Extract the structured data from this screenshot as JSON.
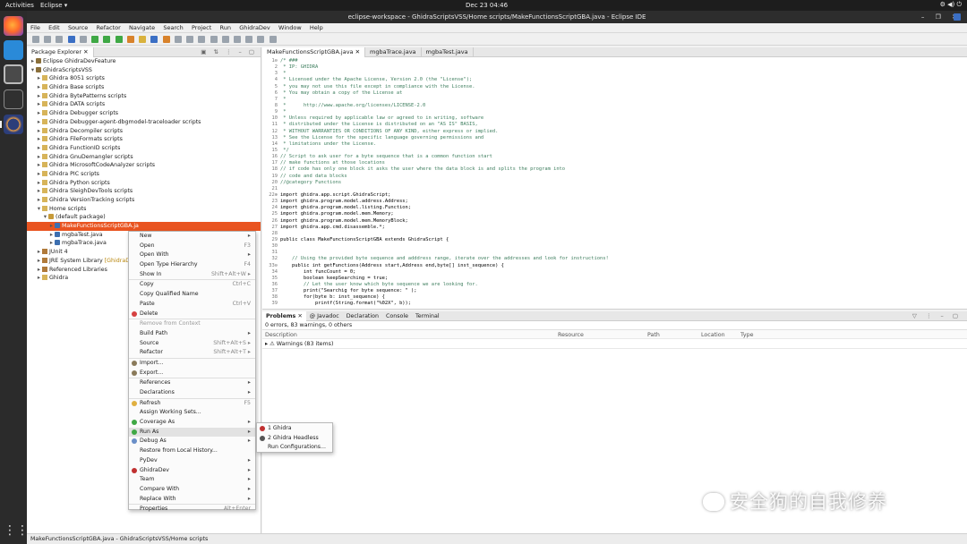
{
  "topbar": {
    "activities": "Activities",
    "app_menu": "Eclipse ▾",
    "clock": "Dec 23  04:46",
    "tray": "⚙ ◀) ⏻"
  },
  "window": {
    "title": "eclipse-workspace - GhidraScriptsVSS/Home scripts/MakeFunctionsScriptGBA.java - Eclipse IDE",
    "controls": "– ❐ ✕"
  },
  "menubar": [
    "File",
    "Edit",
    "Source",
    "Refactor",
    "Navigate",
    "Search",
    "Project",
    "Run",
    "GhidraDev",
    "Window",
    "Help"
  ],
  "explorer": {
    "tab_label": "Package Explorer ✕",
    "tree": [
      {
        "twisty": "▸",
        "icon": "proj",
        "label": "Eclipse GhidraDevFeature",
        "indent": 0
      },
      {
        "twisty": "▾",
        "icon": "proj",
        "label": "GhidraScriptsVSS",
        "indent": 0
      },
      {
        "twisty": "▸",
        "icon": "fold",
        "label": "Ghidra 8051 scripts",
        "indent": 1
      },
      {
        "twisty": "▸",
        "icon": "fold",
        "label": "Ghidra Base scripts",
        "indent": 1
      },
      {
        "twisty": "▸",
        "icon": "fold",
        "label": "Ghidra BytePatterns scripts",
        "indent": 1
      },
      {
        "twisty": "▸",
        "icon": "fold",
        "label": "Ghidra DATA scripts",
        "indent": 1
      },
      {
        "twisty": "▸",
        "icon": "fold",
        "label": "Ghidra Debugger scripts",
        "indent": 1
      },
      {
        "twisty": "▸",
        "icon": "fold",
        "label": "Ghidra Debugger-agent-dbgmodel-traceloader scripts",
        "indent": 1
      },
      {
        "twisty": "▸",
        "icon": "fold",
        "label": "Ghidra Decompiler scripts",
        "indent": 1
      },
      {
        "twisty": "▸",
        "icon": "fold",
        "label": "Ghidra FileFormats scripts",
        "indent": 1
      },
      {
        "twisty": "▸",
        "icon": "fold",
        "label": "Ghidra FunctionID scripts",
        "indent": 1
      },
      {
        "twisty": "▸",
        "icon": "fold",
        "label": "Ghidra GnuDemangler scripts",
        "indent": 1
      },
      {
        "twisty": "▸",
        "icon": "fold",
        "label": "Ghidra MicrosoftCodeAnalyzer scripts",
        "indent": 1
      },
      {
        "twisty": "▸",
        "icon": "fold",
        "label": "Ghidra PIC scripts",
        "indent": 1
      },
      {
        "twisty": "▸",
        "icon": "fold",
        "label": "Ghidra Python scripts",
        "indent": 1
      },
      {
        "twisty": "▸",
        "icon": "fold",
        "label": "Ghidra SleighDevTools scripts",
        "indent": 1
      },
      {
        "twisty": "▸",
        "icon": "fold",
        "label": "Ghidra VersionTracking scripts",
        "indent": 1
      },
      {
        "twisty": "▾",
        "icon": "fold",
        "label": "Home scripts",
        "indent": 1
      },
      {
        "twisty": "▾",
        "icon": "pkg",
        "label": "(default package)",
        "indent": 2
      },
      {
        "twisty": "▸",
        "icon": "java",
        "label": "MakeFunctionsScriptGBA.ja",
        "indent": 3,
        "selected": true
      },
      {
        "twisty": "▸",
        "icon": "java",
        "label": "mgbaTest.java",
        "indent": 3
      },
      {
        "twisty": "▸",
        "icon": "java",
        "label": "mgbaTrace.java",
        "indent": 3
      },
      {
        "twisty": "▸",
        "icon": "lib",
        "label": "JUnit 4",
        "indent": 1
      },
      {
        "twisty": "▸",
        "icon": "lib",
        "label": "JRE System Library",
        "deco": "[GhidraDev",
        "indent": 1
      },
      {
        "twisty": "▸",
        "icon": "lib",
        "label": "Referenced Libraries",
        "indent": 1
      },
      {
        "twisty": "▸",
        "icon": "fold",
        "label": "Ghidra",
        "indent": 1
      }
    ]
  },
  "editor": {
    "tabs": [
      {
        "label": "MakeFunctionsScriptGBA.java ✕",
        "active": true
      },
      {
        "label": "mgbaTrace.java",
        "active": false
      },
      {
        "label": "mgbaTest.java",
        "active": false
      }
    ],
    "lines": [
      {
        "n": "1⊖",
        "t": "/* ###",
        "c": "cg"
      },
      {
        "n": "2",
        "t": " * IP: GHIDRA",
        "c": "cg"
      },
      {
        "n": "3",
        "t": " *",
        "c": "cg"
      },
      {
        "n": "4",
        "t": " * Licensed under the Apache License, Version 2.0 (the \"License\");",
        "c": "cg"
      },
      {
        "n": "5",
        "t": " * you may not use this file except in compliance with the License.",
        "c": "cg"
      },
      {
        "n": "6",
        "t": " * You may obtain a copy of the License at",
        "c": "cg"
      },
      {
        "n": "7",
        "t": " *",
        "c": "cg"
      },
      {
        "n": "8",
        "t": " *      http://www.apache.org/licenses/LICENSE-2.0",
        "c": "cg"
      },
      {
        "n": "9",
        "t": " *",
        "c": "cg"
      },
      {
        "n": "10",
        "t": " * Unless required by applicable law or agreed to in writing, software",
        "c": "cg"
      },
      {
        "n": "11",
        "t": " * distributed under the License is distributed on an \"AS IS\" BASIS,",
        "c": "cg"
      },
      {
        "n": "12",
        "t": " * WITHOUT WARRANTIES OR CONDITIONS OF ANY KIND, either express or implied.",
        "c": "cg"
      },
      {
        "n": "13",
        "t": " * See the License for the specific language governing permissions and",
        "c": "cg"
      },
      {
        "n": "14",
        "t": " * limitations under the License.",
        "c": "cg"
      },
      {
        "n": "15",
        "t": " */",
        "c": "cg"
      },
      {
        "n": "16",
        "t": "// Script to ask user for a byte sequence that is a common function start",
        "c": "cg"
      },
      {
        "n": "17",
        "t": "// make functions at those locations",
        "c": "cg"
      },
      {
        "n": "18",
        "t": "// if code has only one block it asks the user where the data block is and splits the program into",
        "c": "cg"
      },
      {
        "n": "19",
        "t": "// code and data blocks",
        "c": "cg"
      },
      {
        "n": "20",
        "t": "//@category Functions",
        "c": "cg"
      },
      {
        "n": "21",
        "t": "",
        "c": "pl"
      },
      {
        "n": "22⊕",
        "t": "import ghidra.app.script.GhidraScript;",
        "c": "pl"
      },
      {
        "n": "23",
        "t": "import ghidra.program.model.address.Address;",
        "c": "pl"
      },
      {
        "n": "24",
        "t": "import ghidra.program.model.listing.Function;",
        "c": "pl"
      },
      {
        "n": "25",
        "t": "import ghidra.program.model.mem.Memory;",
        "c": "pl"
      },
      {
        "n": "26",
        "t": "import ghidra.program.model.mem.MemoryBlock;",
        "c": "pl"
      },
      {
        "n": "27",
        "t": "import ghidra.app.cmd.disassemble.*;",
        "c": "pl"
      },
      {
        "n": "28",
        "t": "",
        "c": "pl"
      },
      {
        "n": "29",
        "t": "public class MakeFunctionsScriptGBA extends GhidraScript {",
        "c": "pl"
      },
      {
        "n": "30",
        "t": "",
        "c": "pl"
      },
      {
        "n": "31",
        "t": "",
        "c": "pl"
      },
      {
        "n": "32",
        "t": "    // Using the provided byte sequence and adddress range, iterate over the addresses and look for instructions!",
        "c": "cg"
      },
      {
        "n": "33⊖",
        "t": "    public int getFunctions(Address start,Address end,byte[] inst_sequence) {",
        "c": "pl"
      },
      {
        "n": "34",
        "t": "        int funcCount = 0;",
        "c": "pl"
      },
      {
        "n": "35",
        "t": "        boolean keepSearching = true;",
        "c": "pl"
      },
      {
        "n": "36",
        "t": "        // Let the user know which byte sequence we are looking for.",
        "c": "cg"
      },
      {
        "n": "37",
        "t": "        print(\"Searchig for byte sequence: \" );",
        "c": "pl"
      },
      {
        "n": "38",
        "t": "        for(byte b: inst_sequence) {",
        "c": "pl"
      },
      {
        "n": "39",
        "t": "            printf(String.format(\"%02X\", b));",
        "c": "pl"
      }
    ]
  },
  "problems": {
    "tabs": [
      {
        "label": "Problems ✕",
        "active": true
      },
      {
        "label": "@ Javadoc",
        "active": false
      },
      {
        "label": "Declaration",
        "active": false
      },
      {
        "label": "Console",
        "active": false
      },
      {
        "label": "Terminal",
        "active": false
      }
    ],
    "summary": "0 errors, 83 warnings, 0 others",
    "columns": [
      "Description",
      "Resource",
      "Path",
      "Location",
      "Type"
    ],
    "rows": [
      {
        "description": "▸  ⚠ Warnings (83 items)"
      }
    ]
  },
  "statusbar": "MakeFunctionsScriptGBA.java - GhidraScriptsVSS/Home scripts",
  "context_menu": [
    {
      "label": "New",
      "sub": true
    },
    {
      "label": "Open",
      "shortcut": "F3"
    },
    {
      "label": "Open With",
      "sub": true
    },
    {
      "label": "Open Type Hierarchy",
      "shortcut": "F4"
    },
    {
      "label": "Show In",
      "shortcut": "Shift+Alt+W ▸"
    },
    {
      "sep": true
    },
    {
      "label": "Copy",
      "shortcut": "Ctrl+C"
    },
    {
      "label": "Copy Qualified Name"
    },
    {
      "label": "Paste",
      "shortcut": "Ctrl+V"
    },
    {
      "label": "Delete",
      "icon": "#d64040"
    },
    {
      "sep": true
    },
    {
      "label": "Remove from Context",
      "disabled": true
    },
    {
      "label": "Build Path",
      "sub": true
    },
    {
      "label": "Source",
      "shortcut": "Shift+Alt+S ▸"
    },
    {
      "label": "Refactor",
      "shortcut": "Shift+Alt+T ▸"
    },
    {
      "sep": true
    },
    {
      "label": "Import...",
      "icon": "#8a7a5a"
    },
    {
      "label": "Export...",
      "icon": "#8a7a5a"
    },
    {
      "sep": true
    },
    {
      "label": "References",
      "sub": true
    },
    {
      "label": "Declarations",
      "sub": true
    },
    {
      "sep": true
    },
    {
      "label": "Refresh",
      "shortcut": "F5",
      "icon": "#e0b040"
    },
    {
      "label": "Assign Working Sets..."
    },
    {
      "label": "Coverage As",
      "sub": true,
      "icon": "#3fa845"
    },
    {
      "label": "Run As",
      "sub": true,
      "icon": "#3fa845",
      "highlight": true
    },
    {
      "label": "Debug As",
      "sub": true,
      "icon": "#6a8fc8"
    },
    {
      "label": "Restore from Local History..."
    },
    {
      "label": "PyDev",
      "sub": true
    },
    {
      "label": "GhidraDev",
      "sub": true,
      "icon": "#c03030"
    },
    {
      "label": "Team",
      "sub": true
    },
    {
      "label": "Compare With",
      "sub": true
    },
    {
      "label": "Replace With",
      "sub": true
    },
    {
      "sep": true
    },
    {
      "label": "Properties",
      "shortcut": "Alt+Enter"
    }
  ],
  "run_as_submenu": [
    {
      "label": "1 Ghidra",
      "icon": "#c03030"
    },
    {
      "label": "2 Ghidra Headless",
      "icon": "#555555"
    },
    {
      "label": "Run Configurations...",
      "icon": ""
    }
  ],
  "watermark": "安全狗的自我修养",
  "colors": {
    "selection": "#e95420",
    "topbar": "#1d1d1d",
    "dock": "#2b2b2b"
  }
}
